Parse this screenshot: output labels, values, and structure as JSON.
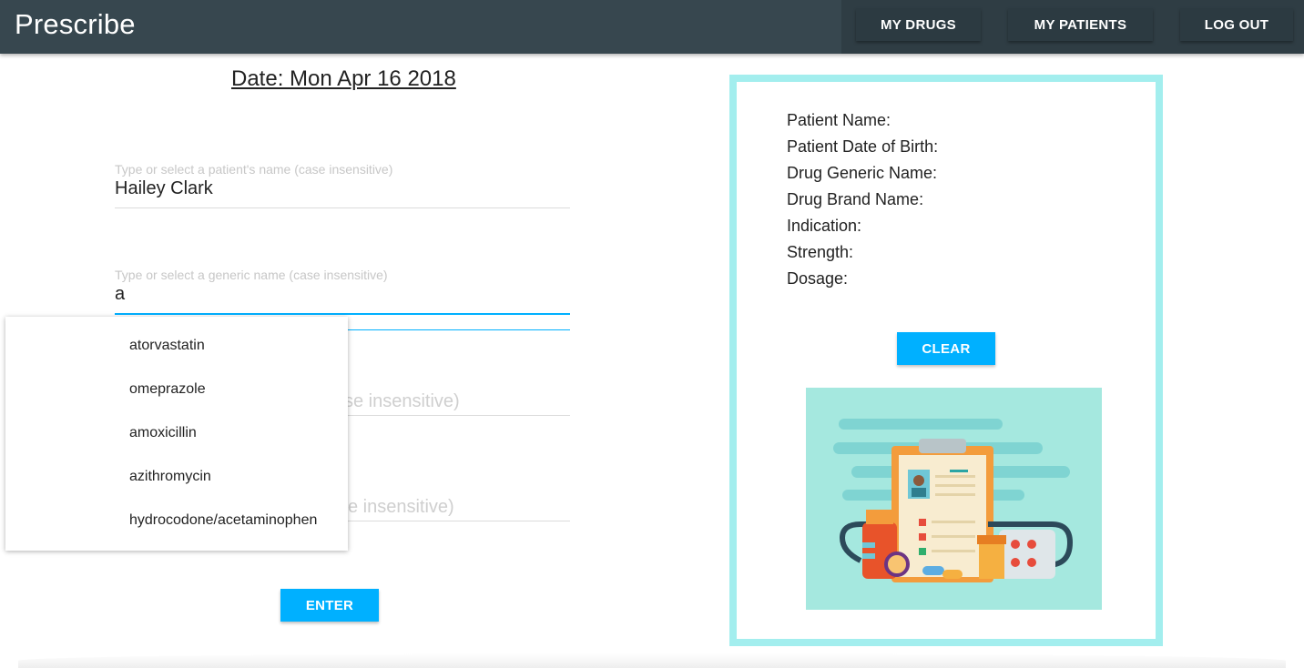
{
  "header": {
    "brand": "Prescribe",
    "nav": [
      "MY DRUGS",
      "MY PATIENTS",
      "LOG OUT"
    ]
  },
  "date_label": "Date:  Mon Apr 16 2018",
  "form": {
    "patient": {
      "placeholder": "Type or select a patient's name (case insensitive)",
      "value": "Hailey Clark"
    },
    "generic": {
      "placeholder": "Type or select a generic name (case insensitive)",
      "value": "a"
    },
    "ghost3": "se insensitive)",
    "ghost4": "e insensitive)",
    "enter_label": "ENTER"
  },
  "suggestions": [
    "atorvastatin",
    "omeprazole",
    "amoxicillin",
    "azithromycin",
    "hydrocodone/acetaminophen"
  ],
  "summary": {
    "labels": [
      "Patient Name:",
      "Patient Date of Birth:",
      "Drug Generic Name:",
      "Drug Brand Name:",
      "Indication:",
      "Strength:",
      "Dosage:"
    ],
    "clear_label": "CLEAR"
  },
  "colors": {
    "header": "#37474f",
    "accent": "#00b0ff",
    "card_border": "#a3eeee",
    "illustration_bg": "#a5e8df"
  }
}
